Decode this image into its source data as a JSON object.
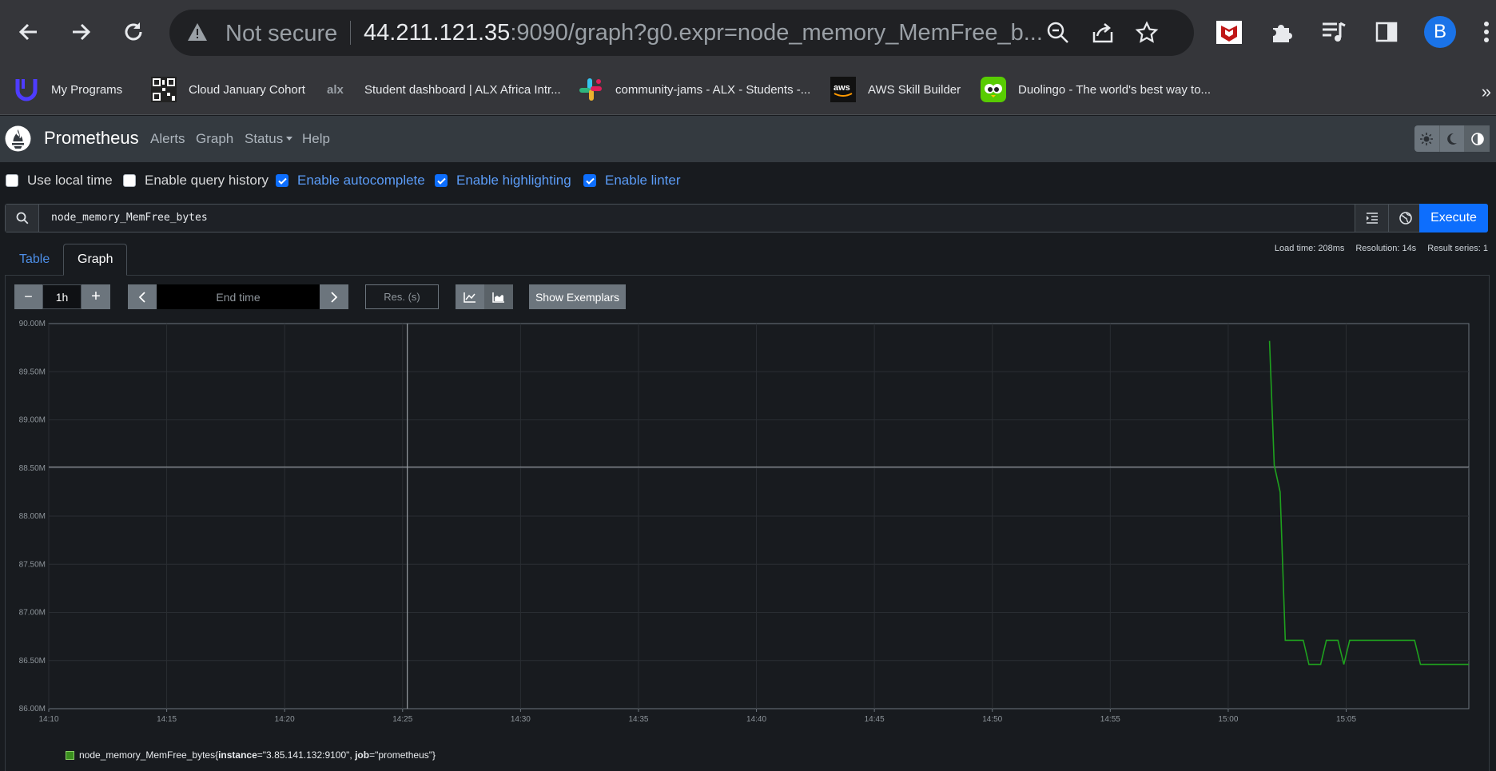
{
  "browser": {
    "security_label": "Not secure",
    "url_host": "44.211.121.35",
    "url_rest": ":9090/graph?g0.expr=node_memory_MemFree_b...",
    "avatar_letter": "B",
    "icons": [
      "back-arrow-icon",
      "forward-arrow-icon",
      "reload-icon",
      "warning-icon",
      "zoom-icon",
      "share-icon",
      "star-icon",
      "mcafee-icon",
      "puzzle-icon",
      "media-icon",
      "sidepanel-icon",
      "menu-dots-icon"
    ]
  },
  "bookmarks": [
    {
      "label": "My Programs"
    },
    {
      "label": "Cloud January Cohort"
    },
    {
      "label": "Student dashboard | ALX Africa Intr..."
    },
    {
      "label": "community-jams - ALX - Students -..."
    },
    {
      "label": "AWS Skill Builder"
    },
    {
      "label": "Duolingo - The world's best way to..."
    }
  ],
  "navbar": {
    "brand": "Prometheus",
    "links": [
      "Alerts",
      "Graph",
      "Status",
      "Help"
    ]
  },
  "options": [
    {
      "label": "Use local time",
      "checked": false
    },
    {
      "label": "Enable query history",
      "checked": false
    },
    {
      "label": "Enable autocomplete",
      "checked": true
    },
    {
      "label": "Enable highlighting",
      "checked": true
    },
    {
      "label": "Enable linter",
      "checked": true
    }
  ],
  "query": {
    "expression": "node_memory_MemFree_bytes",
    "execute_label": "Execute"
  },
  "tabs": [
    "Table",
    "Graph"
  ],
  "stats": {
    "load_time": "Load time: 208ms",
    "resolution": "Resolution: 14s",
    "result_series": "Result series: 1"
  },
  "controls": {
    "minus": "−",
    "range": "1h",
    "plus": "+",
    "end_time_placeholder": "End time",
    "resolution_placeholder": "Res. (s)",
    "exemplars_label": "Show Exemplars"
  },
  "chart_data": {
    "type": "line",
    "ylim": [
      86000000,
      90000000
    ],
    "y_ticks": [
      "90.00M",
      "89.50M",
      "89.00M",
      "88.50M",
      "88.00M",
      "87.50M",
      "87.00M",
      "86.50M",
      "86.00M"
    ],
    "x_ticks": [
      "14:10",
      "14:15",
      "14:20",
      "14:25",
      "14:30",
      "14:35",
      "14:40",
      "14:45",
      "14:50",
      "14:55",
      "15:00",
      "15:05"
    ],
    "x_range_minutes": [
      850,
      910.2
    ],
    "series": [
      {
        "name": "node_memory_MemFree_bytes{instance=\"3.85.141.132:9100\", job=\"prometheus\"}",
        "color": "#1ea11e",
        "points": [
          [
            901.75,
            89820000
          ],
          [
            901.95,
            88530000
          ],
          [
            902.2,
            88250000
          ],
          [
            902.42,
            86710000
          ],
          [
            903.18,
            86710000
          ],
          [
            903.42,
            86460000
          ],
          [
            903.92,
            86460000
          ],
          [
            904.16,
            86710000
          ],
          [
            904.65,
            86710000
          ],
          [
            904.9,
            86460000
          ],
          [
            905.15,
            86710000
          ],
          [
            907.9,
            86710000
          ],
          [
            908.15,
            86460000
          ],
          [
            910.2,
            86460000
          ]
        ]
      }
    ],
    "legend_metric": "node_memory_MemFree_bytes",
    "legend_labels": [
      {
        "key": "instance",
        "value": "\"3.85.141.132:9100\""
      },
      {
        "key": "job",
        "value": "\"prometheus\""
      }
    ],
    "crosshair": {
      "x_minutes": 865.2,
      "y_value": 88510000
    }
  }
}
